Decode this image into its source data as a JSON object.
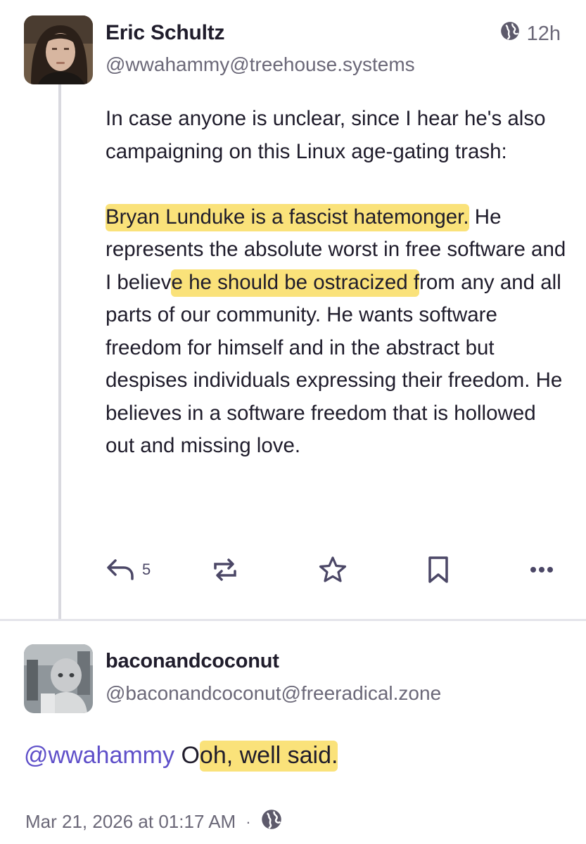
{
  "post": {
    "author": {
      "display_name": "Eric Schultz",
      "handle": "@wwahammy@treehouse.systems"
    },
    "visibility_icon": "globe-icon",
    "time": "12h",
    "paragraph1": "In case anyone is unclear, since I hear he's also campaigning on this Linux age-gating trash:",
    "paragraph2": {
      "hl1": "Bryan Lunduke is a fascist hatemonger.",
      "t1": " He represents the absolute worst in free software and I believ",
      "hl2": "e he should be ostracized f",
      "t2": "rom any and all parts of our community. He wants software freedom for himself and in the abstract but despises individuals expressing their freedom. He believes in a software freedom that is hollowed out and missing love."
    },
    "actions": {
      "reply_count": "5",
      "icons": [
        "reply-icon",
        "boost-icon",
        "star-icon",
        "bookmark-icon",
        "more-icon"
      ]
    }
  },
  "reply": {
    "author": {
      "display_name": "baconandcoconut",
      "handle": "@baconandcoconut@freeradical.zone"
    },
    "mention": "@wwahammy",
    "pre_highlight": " O",
    "highlight": "oh, well said.",
    "timestamp": "Mar 21, 2026 at 01:17 AM",
    "separator": "·",
    "visibility_icon": "globe-icon"
  },
  "colors": {
    "highlight": "#fae27a",
    "mention": "#5e4fc9",
    "muted": "#6b6878",
    "icon": "#4b4766"
  }
}
